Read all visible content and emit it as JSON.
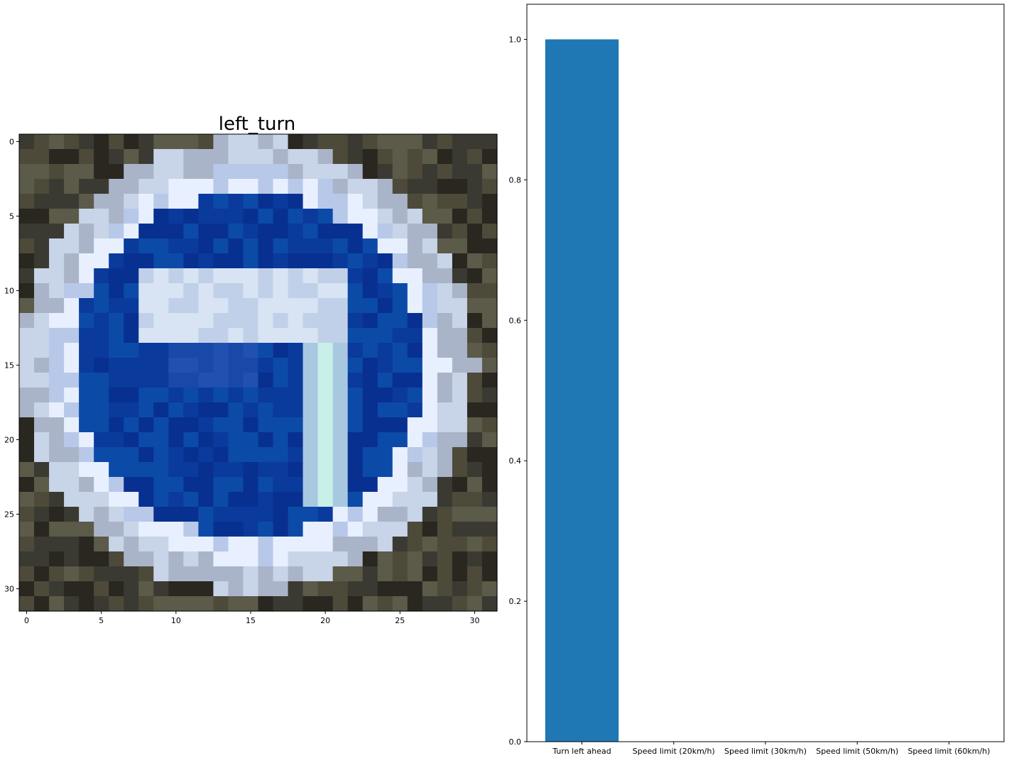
{
  "image_panel": {
    "title": "left_turn",
    "xticks": [
      0,
      5,
      10,
      15,
      20,
      25,
      30
    ],
    "yticks": [
      0,
      5,
      10,
      15,
      20,
      25,
      30
    ],
    "grid_size": 32,
    "pixel_summary": {
      "background_colors": [
        "#3a3a32",
        "#4d4a3a",
        "#5c5a48",
        "#2a2620"
      ],
      "ring_outer_color": "#c8d4e8",
      "ring_inner_color": "#e8f0ff",
      "sign_fill_color": "#0a3a9c",
      "arrow_color": "#0a3a9c",
      "arrow_highlight_color": "#c8f0e8"
    }
  },
  "chart_data": {
    "type": "bar",
    "categories": [
      "Turn left ahead",
      "Speed limit (20km/h)",
      "Speed limit (30km/h)",
      "Speed limit (50km/h)",
      "Speed limit (60km/h)"
    ],
    "values": [
      1.0,
      0.0,
      0.0,
      0.0,
      0.0
    ],
    "title": "",
    "xlabel": "",
    "ylabel": "",
    "ylim": [
      0,
      1.05
    ],
    "yticks": [
      "0.0",
      "0.2",
      "0.4",
      "0.6",
      "0.8",
      "1.0"
    ],
    "bar_color": "#1f77b4",
    "grid": false
  }
}
